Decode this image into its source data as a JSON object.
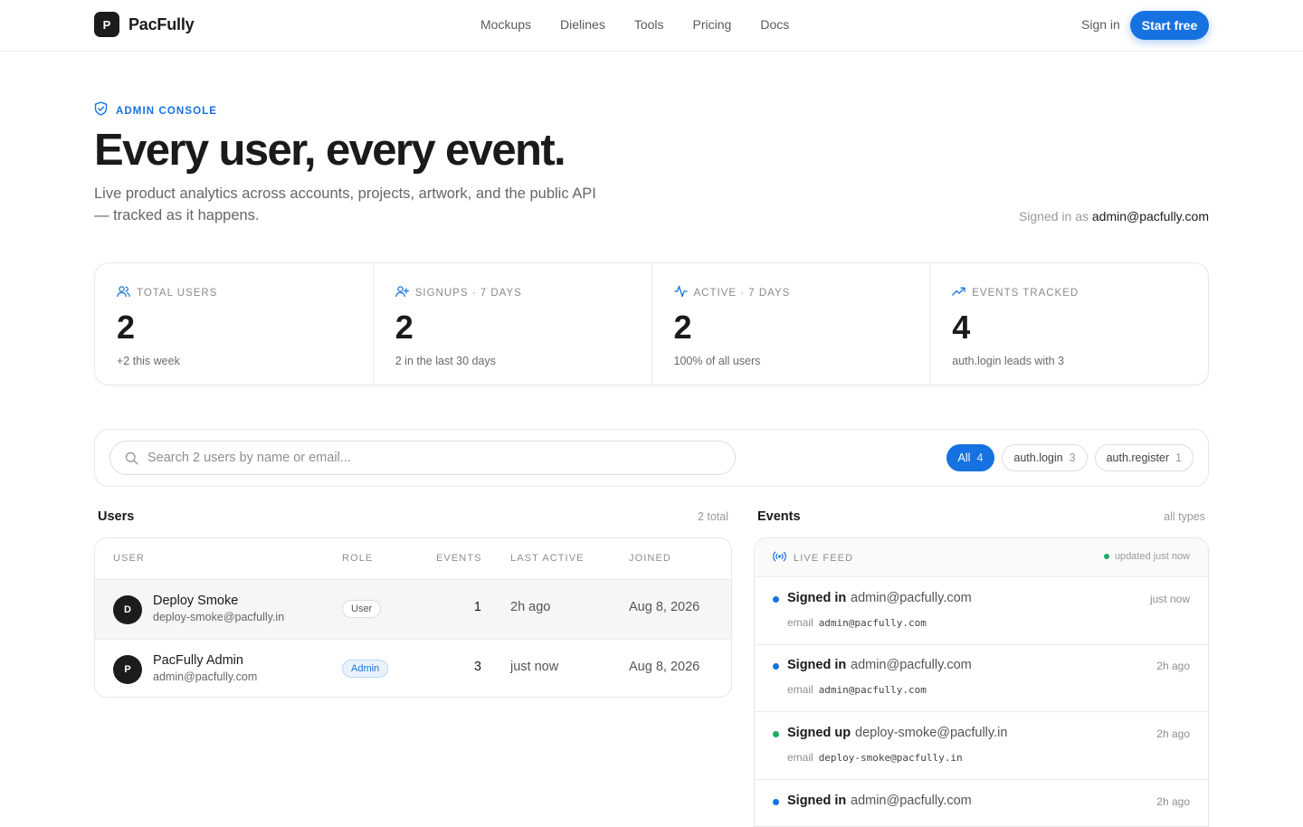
{
  "app": {
    "logo_letter": "P",
    "name": "PacFully"
  },
  "nav": {
    "links": [
      "Mockups",
      "Dielines",
      "Tools",
      "Pricing",
      "Docs"
    ],
    "signin": "Sign in",
    "cta": "Start free"
  },
  "hero": {
    "eyebrow": "ADMIN CONSOLE",
    "title": "Every user, every event.",
    "subtitle": "Live product analytics across accounts, projects, artwork, and the public API — tracked as it happens.",
    "signed_in_prefix": "Signed in as",
    "signed_in_email": "admin@pacfully.com"
  },
  "stats": [
    {
      "icon": "users-icon",
      "label": "TOTAL USERS",
      "value": "2",
      "note": "+2 this week"
    },
    {
      "icon": "user-plus-icon",
      "label": "SIGNUPS · 7 DAYS",
      "value": "2",
      "note": "2 in the last 30 days"
    },
    {
      "icon": "activity-icon",
      "label": "ACTIVE · 7 DAYS",
      "value": "2",
      "note": "100% of all users"
    },
    {
      "icon": "trending-up-icon",
      "label": "EVENTS TRACKED",
      "value": "4",
      "note": "auth.login leads with 3"
    }
  ],
  "search": {
    "placeholder": "Search 2 users by name or email...",
    "value": ""
  },
  "filters": [
    {
      "label": "All",
      "count": "4",
      "active": true
    },
    {
      "label": "auth.login",
      "count": "3",
      "active": false
    },
    {
      "label": "auth.register",
      "count": "1",
      "active": false
    }
  ],
  "users": {
    "title": "Users",
    "meta": "2 total",
    "columns": [
      "USER",
      "ROLE",
      "EVENTS",
      "LAST ACTIVE",
      "JOINED"
    ],
    "rows": [
      {
        "initial": "D",
        "name": "Deploy Smoke",
        "email": "deploy-smoke@pacfully.in",
        "role": "User",
        "events": "1",
        "last_active": "2h ago",
        "joined": "Aug 8, 2026"
      },
      {
        "initial": "P",
        "name": "PacFully Admin",
        "email": "admin@pacfully.com",
        "role": "Admin",
        "events": "3",
        "last_active": "just now",
        "joined": "Aug 8, 2026"
      }
    ]
  },
  "events": {
    "title": "Events",
    "meta": "all types",
    "feed_title": "LIVE FEED",
    "updated": "updated just now",
    "items": [
      {
        "type": "Signed in",
        "user": "admin@pacfully.com",
        "time": "just now",
        "detail_label": "email",
        "detail_value": "admin@pacfully.com",
        "color": "#1672e0"
      },
      {
        "type": "Signed in",
        "user": "admin@pacfully.com",
        "time": "2h ago",
        "detail_label": "email",
        "detail_value": "admin@pacfully.com",
        "color": "#1672e0"
      },
      {
        "type": "Signed up",
        "user": "deploy-smoke@pacfully.in",
        "time": "2h ago",
        "detail_label": "email",
        "detail_value": "deploy-smoke@pacfully.in",
        "color": "#1eaa6a"
      },
      {
        "type": "Signed in",
        "user": "admin@pacfully.com",
        "time": "2h ago",
        "detail_label": "",
        "detail_value": "",
        "color": "#1672e0"
      }
    ]
  }
}
